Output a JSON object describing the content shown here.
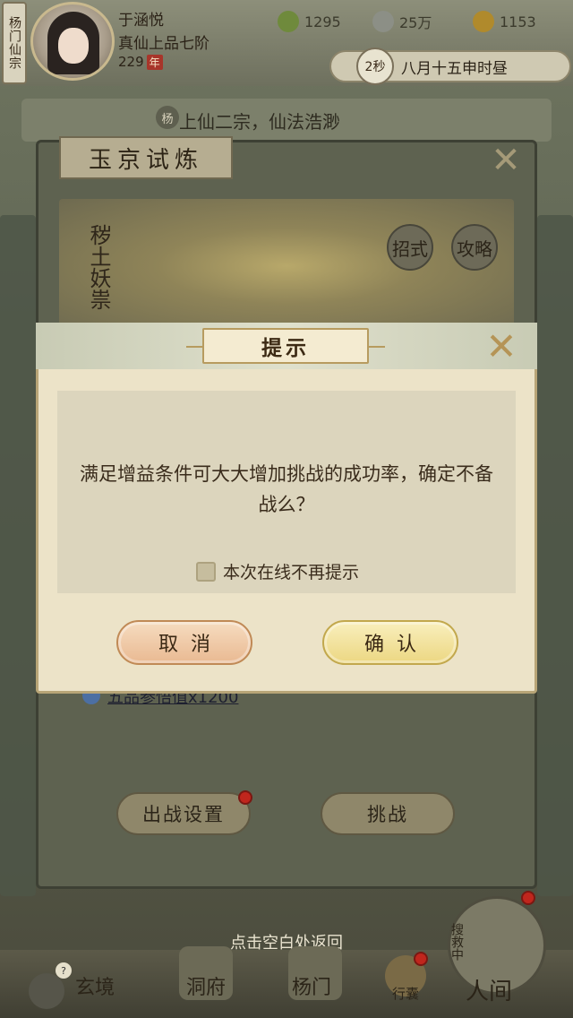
{
  "player": {
    "sect_tag": "杨门仙宗",
    "name": "于涵悦",
    "rank": "真仙上品七阶",
    "age": "229",
    "age_unit": "年"
  },
  "resources": {
    "jade": "1295",
    "coins": "25万",
    "power": "1153"
  },
  "time": {
    "countdown": "2秒",
    "label": "八月十五申时昼"
  },
  "notice": {
    "badge": "杨",
    "text": "上仙二宗，仙法浩渺"
  },
  "panel": {
    "title": "玉京试炼",
    "close_icon": "close-icon",
    "boss_name": "秽土妖祟",
    "buttons": {
      "moves": "招式",
      "strategy": "攻略",
      "battle_setup": "出战设置",
      "challenge": "挑战"
    },
    "reward": {
      "item": "五品参悟值",
      "multiplier": "x1200"
    }
  },
  "dialog": {
    "title": "提示",
    "message": "满足增益条件可大大增加挑战的成功率，确定不备战么？",
    "checkbox_label": "本次在线不再提示",
    "checkbox_checked": false,
    "cancel_label": "取消",
    "confirm_label": "确认"
  },
  "bottom": {
    "hint": "点击空白处返回",
    "nav": [
      "玄境",
      "洞府",
      "杨门",
      "行囊",
      "人间"
    ],
    "search_badge": "搜救中",
    "chat_badge_count": "?"
  },
  "colors": {
    "accent_gold": "#b59456",
    "cancel_btn": "#e9b992",
    "confirm_btn": "#ecd782",
    "dot_red": "#c0261d"
  }
}
